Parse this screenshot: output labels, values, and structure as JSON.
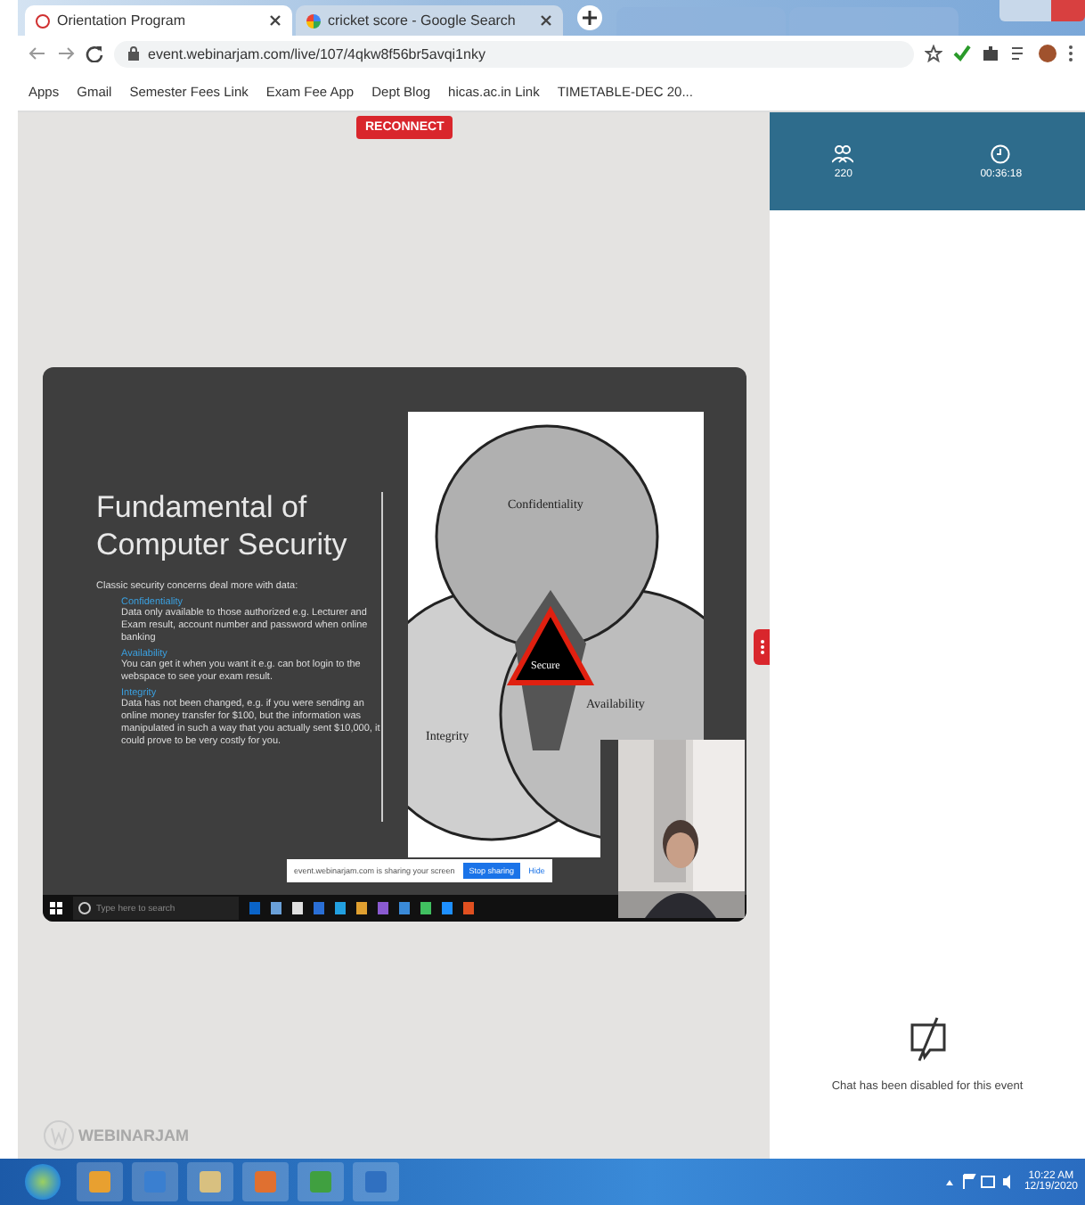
{
  "browser": {
    "tabs": [
      {
        "title": "Orientation Program",
        "selected": true
      },
      {
        "title": "cricket score - Google Search",
        "selected": false
      }
    ],
    "address": "event.webinarjam.com/live/107/4qkw8f56br5avqi1nky",
    "bookmarks": [
      "Apps",
      "Gmail",
      "Semester Fees Link",
      "Exam Fee App",
      "Dept Blog",
      "hicas.ac.in Link",
      "TIMETABLE-DEC 20..."
    ]
  },
  "reconnect": "RECONNECT",
  "stats": {
    "attendees": "220",
    "timer": "00:36:18"
  },
  "slide": {
    "title": "Fundamental of Computer Security",
    "bullet": "Classic security concerns deal more with data:",
    "items": [
      {
        "heading": "Confidentiality",
        "text": "Data only available to those authorized e.g. Lecturer and Exam result, account number and password when online banking"
      },
      {
        "heading": "Availability",
        "text": "You can get it when you want it e.g. can bot login to the webspace to see your exam result."
      },
      {
        "heading": "Integrity",
        "text": "Data has not been changed, e.g. if you were sending an online money transfer for $100, but the information was manipulated in such a way that you actually sent $10,000, it could prove to be very costly for you."
      }
    ],
    "venn": {
      "top": "Confidentiality",
      "left": "Integrity",
      "right": "Availability",
      "center": "Secure"
    },
    "share_bar": {
      "message": "event.webinarjam.com is sharing your screen",
      "stop": "Stop sharing",
      "hide": "Hide"
    },
    "search_placeholder": "Type here to search"
  },
  "chat": {
    "message": "Chat has been disabled for this event"
  },
  "logo": "WEBINARJAM",
  "taskbar": {
    "time": "10:22 AM",
    "date": "12/19/2020"
  }
}
